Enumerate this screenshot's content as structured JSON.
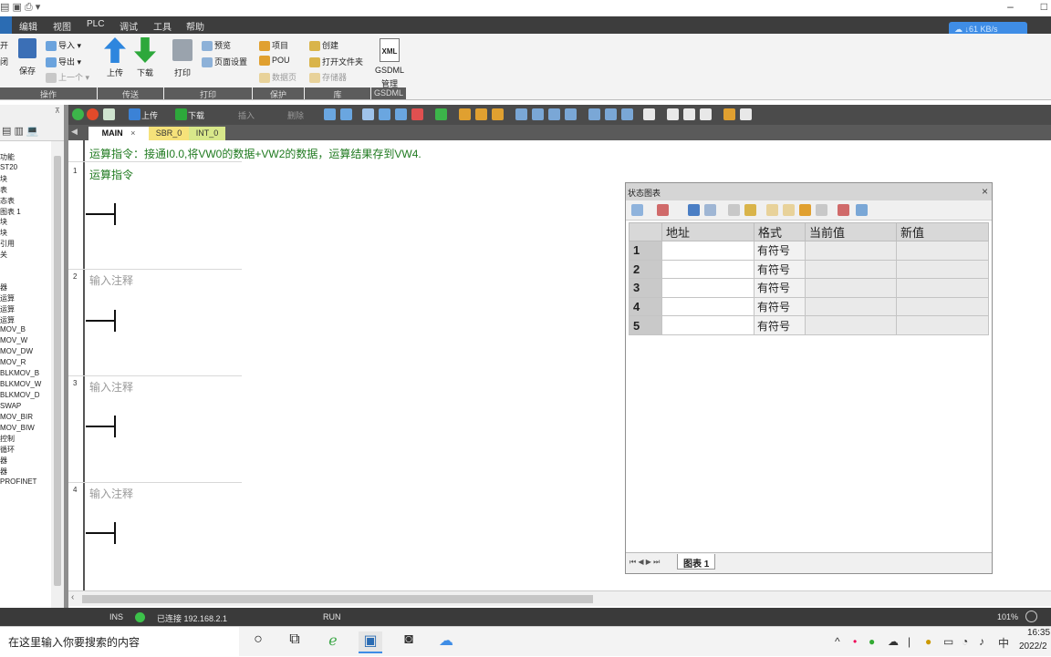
{
  "menu": {
    "items": [
      "编辑",
      "视图",
      "PLC",
      "调试",
      "工具",
      "帮助"
    ]
  },
  "net_speed": "↓61 KB/s",
  "ribbon": {
    "groups": [
      {
        "name": "操作",
        "items": [
          "开",
          "闭",
          "保存",
          "导入",
          "导出",
          "上一个"
        ]
      },
      {
        "name": "传送",
        "items": [
          "上传",
          "下载"
        ]
      },
      {
        "name": "打印",
        "items": [
          "打印",
          "预览",
          "页面设置"
        ]
      },
      {
        "name": "保护",
        "items": [
          "项目",
          "POU",
          "数据页"
        ]
      },
      {
        "name": "库",
        "items": [
          "创建",
          "打开文件夹",
          "存储器"
        ]
      },
      {
        "name": "GSDML",
        "items": [
          "GSDML",
          "管理"
        ]
      }
    ],
    "xml_label": "XML"
  },
  "left_tree": {
    "items": [
      "功能",
      "ST20",
      "块",
      "表",
      "态表",
      "图表 1",
      "块",
      "块",
      "引用",
      "关",
      "",
      "",
      "器",
      "运算",
      "运算",
      "运算",
      "MOV_B",
      "MOV_W",
      "MOV_DW",
      "MOV_R",
      "BLKMOV_B",
      "BLKMOV_W",
      "BLKMOV_D",
      "SWAP",
      "MOV_BIR",
      "MOV_BIW",
      "控制",
      "循环",
      "器",
      "器",
      "PROFINET"
    ]
  },
  "editor_toolbar": {
    "upload": "上传",
    "download": "下载",
    "insert": "插入",
    "delete": "删除"
  },
  "tabs": [
    "MAIN",
    "SBR_0",
    "INT_0"
  ],
  "program_comment": "运算指令：接通I0.0,将VW0的数据+VW2的数据，运算结果存到VW4.",
  "networks": [
    {
      "num": "1",
      "title": "运算指令"
    },
    {
      "num": "2",
      "title": "输入注释"
    },
    {
      "num": "3",
      "title": "输入注释"
    },
    {
      "num": "4",
      "title": "输入注释"
    }
  ],
  "status_chart": {
    "title": "状态图表",
    "columns": [
      "",
      "地址",
      "格式",
      "当前值",
      "新值"
    ],
    "rows": [
      {
        "num": "1",
        "address": "",
        "format": "有符号",
        "current": "",
        "new": ""
      },
      {
        "num": "2",
        "address": "",
        "format": "有符号",
        "current": "",
        "new": ""
      },
      {
        "num": "3",
        "address": "",
        "format": "有符号",
        "current": "",
        "new": ""
      },
      {
        "num": "4",
        "address": "",
        "format": "有符号",
        "current": "",
        "new": ""
      },
      {
        "num": "5",
        "address": "",
        "format": "有符号",
        "current": "",
        "new": ""
      }
    ],
    "sheet_tab": "图表 1"
  },
  "statusbar": {
    "mode": "INS",
    "connection": "已连接 192.168.2.1",
    "run": "RUN",
    "zoom": "101%"
  },
  "taskbar": {
    "search_placeholder": "在这里输入你要搜索的内容",
    "ime": "中",
    "time": "16:35",
    "date": "2022/2"
  },
  "colors": {
    "accent": "#3f8de6",
    "comment_green": "#1f7a1f",
    "toolbar_dark": "#4b4b4b"
  }
}
